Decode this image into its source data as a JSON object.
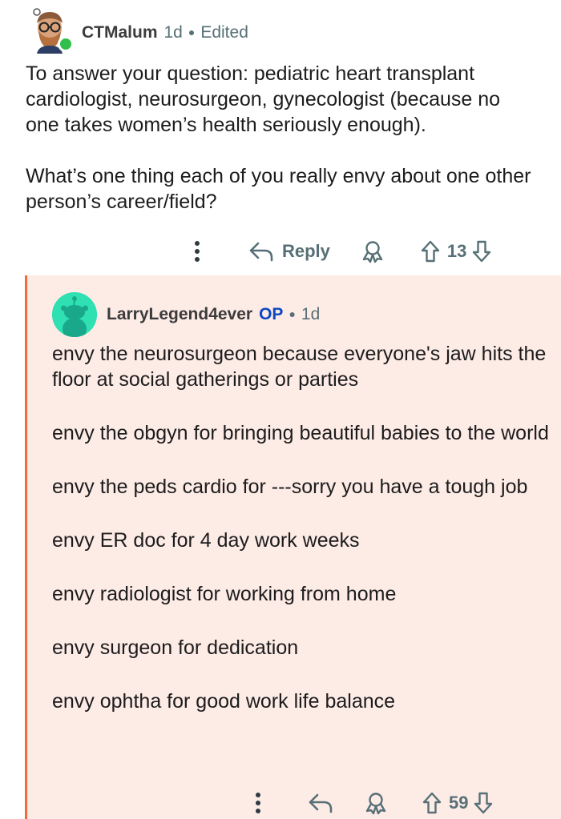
{
  "comment": {
    "username": "CTMalum",
    "age": "1d",
    "edited": "Edited",
    "paragraphs": [
      "To answer your question: pediatric heart transplant cardiologist, neurosurgeon, gynecologist (because no one takes women’s health seriously enough).",
      "What’s one thing each of you really envy about one other person’s career/field?"
    ],
    "reply_label": "Reply",
    "score": "13"
  },
  "reply": {
    "username": "LarryLegend4ever",
    "op_label": "OP",
    "age": "1d",
    "paragraphs": [
      "envy the neurosurgeon because everyone's jaw hits the floor at social gatherings or parties",
      "envy the obgyn for bringing beautiful babies to the world",
      "envy the peds cardio for ---sorry you have a tough job",
      "envy ER doc for 4 day work weeks",
      "envy radiologist for working from home",
      "envy surgeon for dedication",
      "envy ophtha for good work life balance"
    ],
    "score": "59"
  },
  "icons": {
    "more": "more-vertical-icon",
    "reply": "reply-arrow-icon",
    "award": "award-icon",
    "upvote": "upvote-arrow-icon",
    "downvote": "downvote-arrow-icon"
  },
  "colors": {
    "op_accent": "#0d47c2",
    "thread_line": "#f26b3a",
    "reply_background": "#fdebe6",
    "online": "#2fbf4a",
    "meta_text": "#576f76",
    "snoo_background": "#2ee0b2"
  }
}
